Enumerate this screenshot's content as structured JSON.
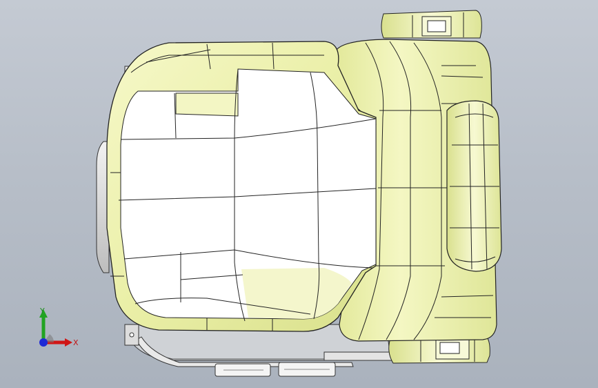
{
  "viewport": {
    "background": "#b9c0ca",
    "model": "seat-assembly-top-view",
    "surface_color": "#f2f5b4",
    "edge_color": "#1e1e1e"
  },
  "triad": {
    "x_label": "X",
    "y_label": "Y",
    "x_color": "#d01616",
    "y_color": "#22a322",
    "z_color": "#1e2ad6"
  }
}
